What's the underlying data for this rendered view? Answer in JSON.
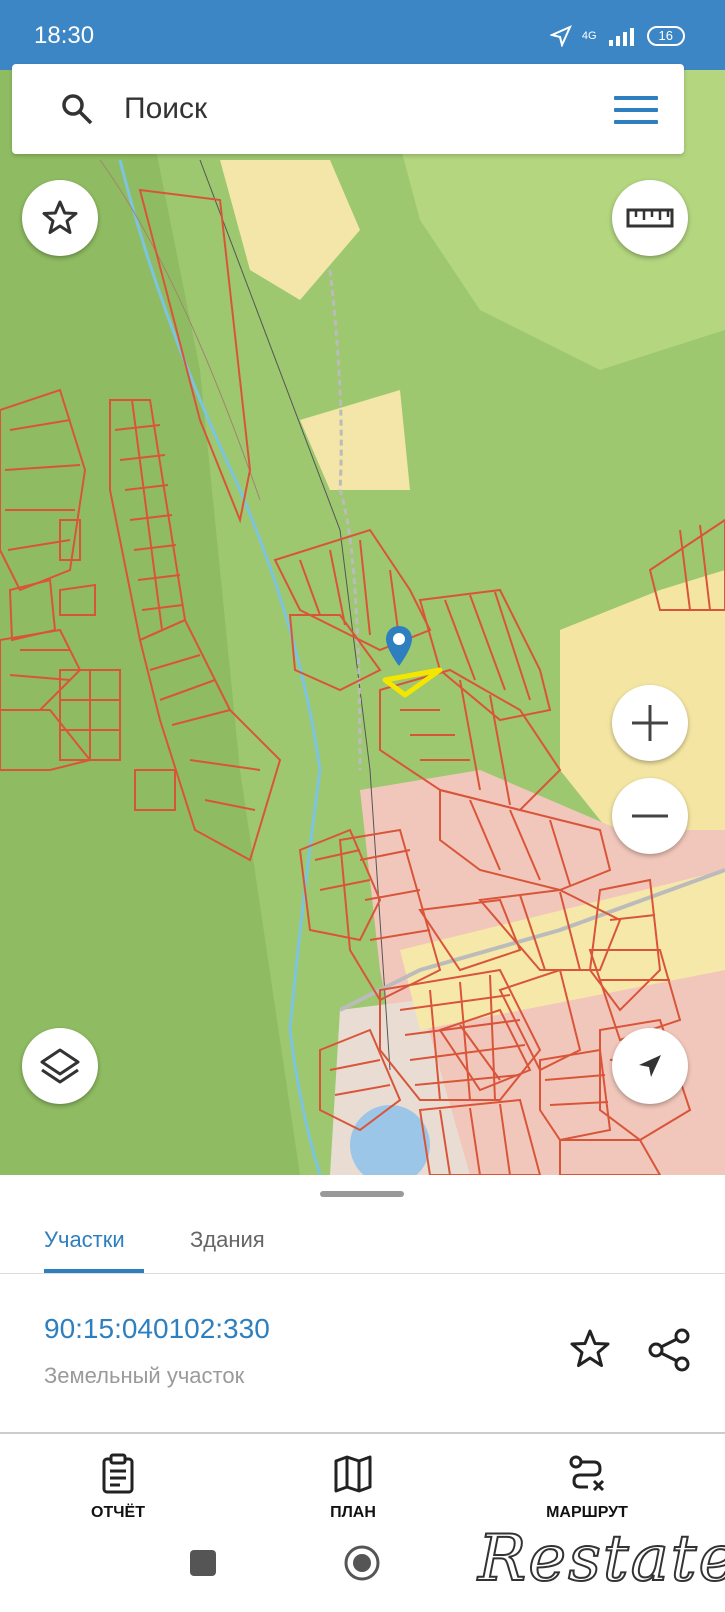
{
  "status_bar": {
    "time": "18:30",
    "network": "4G",
    "battery": "16"
  },
  "search": {
    "placeholder": "Поиск"
  },
  "map": {
    "controls": {
      "favorites_icon": "star-outline-icon",
      "ruler_icon": "ruler-icon",
      "zoom_in_icon": "plus-icon",
      "zoom_out_icon": "minus-icon",
      "layers_icon": "layers-icon",
      "locate_icon": "navigation-arrow-icon"
    },
    "selected_marker_color": "#2e7fbf",
    "selected_parcel_color": "#ffee00"
  },
  "sheet": {
    "tabs": [
      {
        "label": "Участки",
        "active": true
      },
      {
        "label": "Здания",
        "active": false
      }
    ],
    "parcel": {
      "cadastral_number": "90:15:040102:330",
      "type": "Земельный участок"
    },
    "actions": [
      {
        "label": "ОТЧЁТ",
        "icon": "report-clipboard-icon"
      },
      {
        "label": "ПЛАН",
        "icon": "map-plan-icon"
      },
      {
        "label": "МАРШРУТ",
        "icon": "route-icon"
      }
    ]
  },
  "watermark": {
    "text": "Restate"
  },
  "colors": {
    "accent": "#2e7fbf",
    "status_bar": "#3d86c6",
    "parcel_outline": "#d9553a"
  }
}
